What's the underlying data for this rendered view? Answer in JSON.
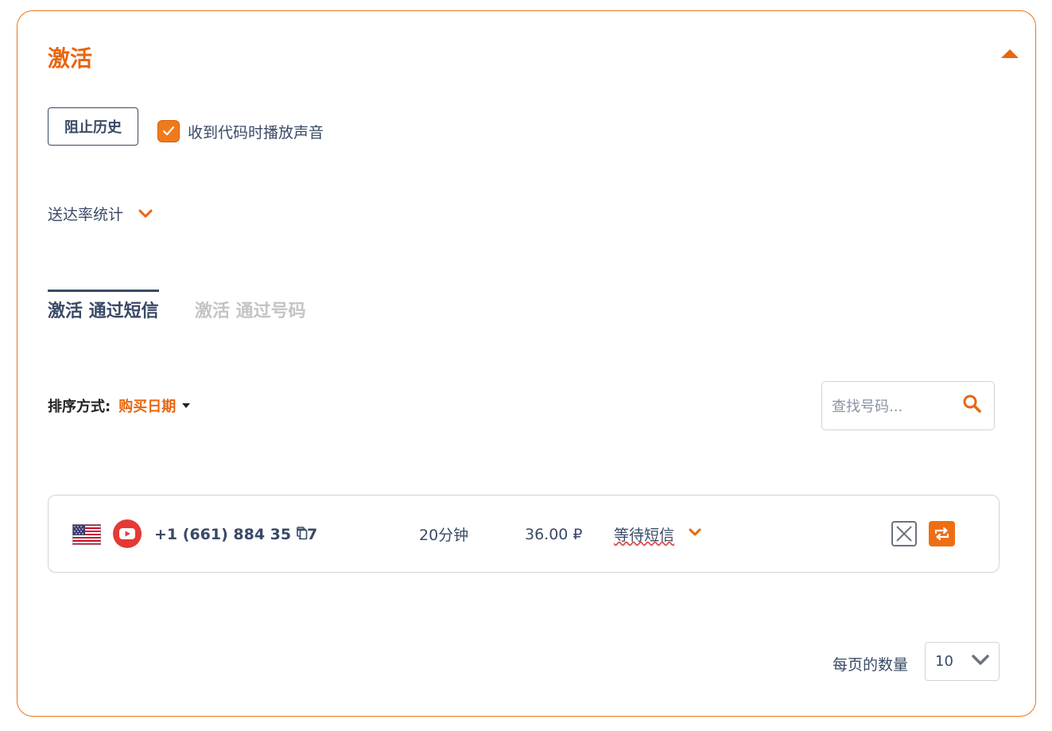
{
  "panel": {
    "title": "激活",
    "collapse_icon": "triangle-up-icon"
  },
  "controls": {
    "block_history_label": "阻止历史",
    "play_sound_label": "收到代码时播放声音",
    "play_sound_checked": true
  },
  "stats": {
    "label": "送达率统计",
    "icon": "chevron-down-icon"
  },
  "tabs": [
    {
      "label": "激活 通过短信",
      "active": true
    },
    {
      "label": "激活 通过号码",
      "active": false
    }
  ],
  "sort": {
    "label": "排序方式:",
    "value": "购买日期"
  },
  "search": {
    "placeholder": "查找号码..."
  },
  "activations": [
    {
      "country_flag": "us-flag-icon",
      "service_icon": "youtube-icon",
      "phone": "+1 (661) 884 35 77",
      "time_left": "20分钟",
      "price": "36.00 ₽",
      "status": "等待短信"
    }
  ],
  "pagination": {
    "per_page_label": "每页的数量",
    "per_page_value": "10"
  },
  "colors": {
    "accent": "#e8650f",
    "text": "#3a4a66",
    "border": "#cfd4da",
    "inactive_tab": "#c4c4c4"
  }
}
